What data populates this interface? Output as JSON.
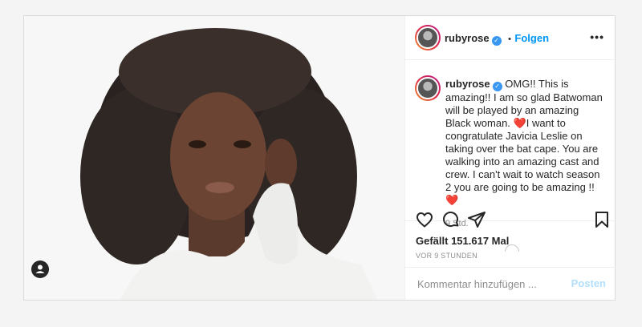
{
  "post": {
    "username": "rubyrose",
    "verified_icon": "verified-badge-icon",
    "follow_separator": "•",
    "follow_label": "Folgen",
    "more_icon": "more-options-icon",
    "more_label": "•••",
    "caption_text": "OMG!! This is amazing!! I am so glad Batwoman will be played by an amazing Black woman. ❤️I want to congratulate Javicia Leslie on taking over the bat cape.  You are walking into an amazing cast and crew.  I can't wait to watch season 2 you are going to be amazing !! ❤️",
    "caption_time": "9 Std.",
    "likes": "Gefällt 151.617 Mal",
    "date": "VOR 9 STUNDEN",
    "comment_placeholder": "Kommentar hinzufügen ...",
    "post_button": "Posten",
    "colors": {
      "link": "#0095f6",
      "verified": "#3897f0",
      "heart": "#e0245e",
      "post_disabled": "#b2dffc"
    },
    "icons": [
      "heart-icon",
      "comment-icon",
      "share-icon",
      "bookmark-icon",
      "tagged-user-icon"
    ]
  }
}
